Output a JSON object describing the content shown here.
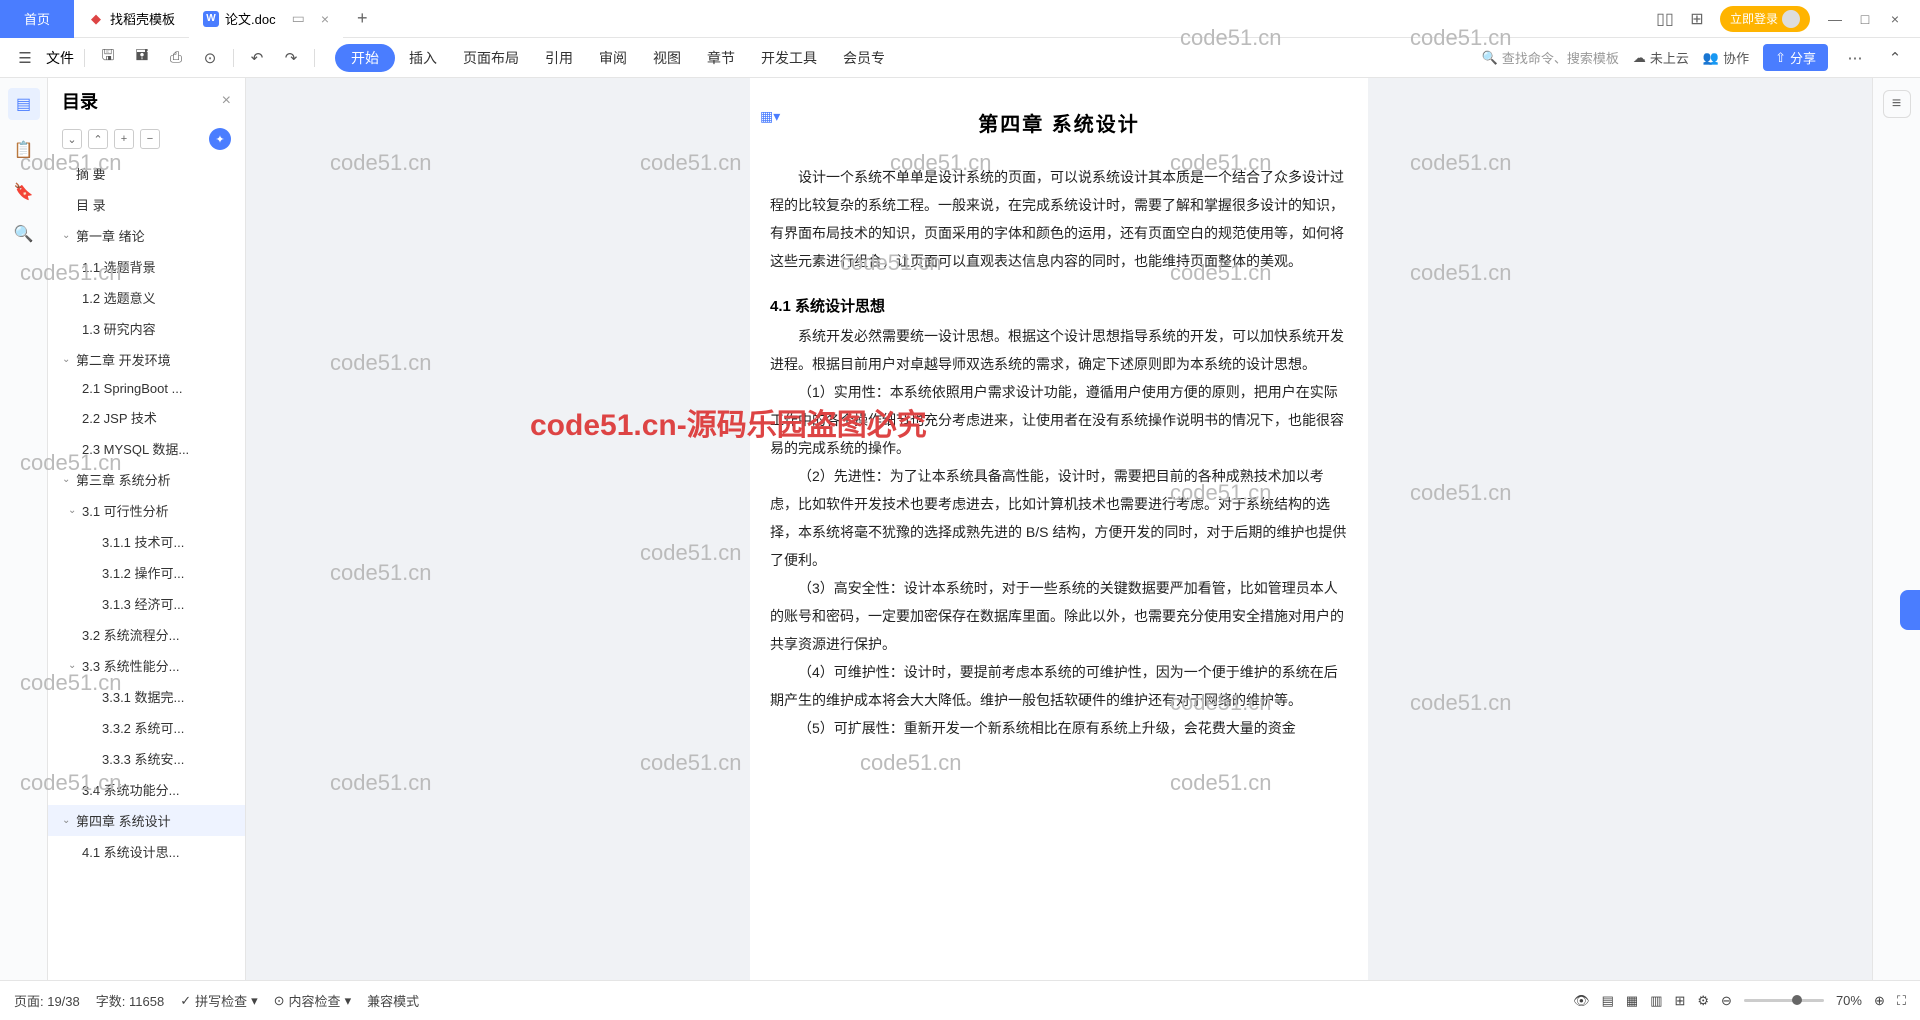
{
  "titlebar": {
    "home": "首页",
    "tab1": "找稻壳模板",
    "tab2": "论文.doc",
    "login": "立即登录"
  },
  "toolbar": {
    "file": "文件",
    "menus": [
      "开始",
      "插入",
      "页面布局",
      "引用",
      "审阅",
      "视图",
      "章节",
      "开发工具",
      "会员专"
    ],
    "search": "查找命令、搜索模板",
    "cloud": "未上云",
    "collab": "协作",
    "share": "分享"
  },
  "outline": {
    "title": "目录",
    "items": [
      {
        "t": "摘  要",
        "lv": "l1nc"
      },
      {
        "t": "目  录",
        "lv": "l1nc"
      },
      {
        "t": "第一章  绪论",
        "lv": "l1",
        "c": true
      },
      {
        "t": "1.1  选题背景",
        "lv": "l2"
      },
      {
        "t": "1.2  选题意义",
        "lv": "l2"
      },
      {
        "t": "1.3  研究内容",
        "lv": "l2"
      },
      {
        "t": "第二章  开发环境",
        "lv": "l1",
        "c": true
      },
      {
        "t": "2.1 SpringBoot ...",
        "lv": "l2"
      },
      {
        "t": "2.2 JSP 技术",
        "lv": "l2"
      },
      {
        "t": "2.3 MYSQL 数据...",
        "lv": "l2"
      },
      {
        "t": "第三章  系统分析",
        "lv": "l1",
        "c": true
      },
      {
        "t": "3.1 可行性分析",
        "lv": "l2c",
        "c": true
      },
      {
        "t": "3.1.1 技术可...",
        "lv": "l3"
      },
      {
        "t": "3.1.2 操作可...",
        "lv": "l3"
      },
      {
        "t": "3.1.3 经济可...",
        "lv": "l3"
      },
      {
        "t": "3.2 系统流程分...",
        "lv": "l2"
      },
      {
        "t": "3.3 系统性能分...",
        "lv": "l2c",
        "c": true
      },
      {
        "t": "3.3.1 数据完...",
        "lv": "l3"
      },
      {
        "t": "3.3.2 系统可...",
        "lv": "l3"
      },
      {
        "t": "3.3.3 系统安...",
        "lv": "l3"
      },
      {
        "t": "3.4 系统功能分...",
        "lv": "l2"
      },
      {
        "t": "第四章  系统设计",
        "lv": "l1",
        "c": true,
        "sel": true
      },
      {
        "t": "4.1  系统设计思...",
        "lv": "l2"
      }
    ]
  },
  "doc": {
    "title": "第四章  系统设计",
    "p1": "设计一个系统不单单是设计系统的页面，可以说系统设计其本质是一个结合了众多设计过程的比较复杂的系统工程。一般来说，在完成系统设计时，需要了解和掌握很多设计的知识，有界面布局技术的知识，页面采用的字体和颜色的运用，还有页面空白的规范使用等，如何将这些元素进行组合，让页面可以直观表达信息内容的同时，也能维持页面整体的美观。",
    "h1": "4.1  系统设计思想",
    "p2": "系统开发必然需要统一设计思想。根据这个设计思想指导系统的开发，可以加快系统开发进程。根据目前用户对卓越导师双选系统的需求，确定下述原则即为本系统的设计思想。",
    "p3": "（1）实用性：本系统依照用户需求设计功能，遵循用户使用方便的原则，把用户在实际工作中的各个操作细节也充分考虑进来，让使用者在没有系统操作说明书的情况下，也能很容易的完成系统的操作。",
    "p4": "（2）先进性：为了让本系统具备高性能，设计时，需要把目前的各种成熟技术加以考虑，比如软件开发技术也要考虑进去，比如计算机技术也需要进行考虑。对于系统结构的选择，本系统将毫不犹豫的选择成熟先进的 B/S 结构，方便开发的同时，对于后期的维护也提供了便利。",
    "p5": "（3）高安全性：设计本系统时，对于一些系统的关键数据要严加看管，比如管理员本人的账号和密码，一定要加密保存在数据库里面。除此以外，也需要充分使用安全措施对用户的共享资源进行保护。",
    "p6": "（4）可维护性：设计时，要提前考虑本系统的可维护性，因为一个便于维护的系统在后期产生的维护成本将会大大降低。维护一般包括软硬件的维护还有对于网络的维护等。",
    "p7": "（5）可扩展性：重新开发一个新系统相比在原有系统上升级，会花费大量的资金"
  },
  "status": {
    "page": "页面: 19/38",
    "words": "字数: 11658",
    "spell": "拼写检查",
    "content": "内容检查",
    "compat": "兼容模式",
    "zoom": "70%"
  },
  "watermark": "code51.cn-源码乐园盗图必究",
  "wmg": "code51.cn"
}
